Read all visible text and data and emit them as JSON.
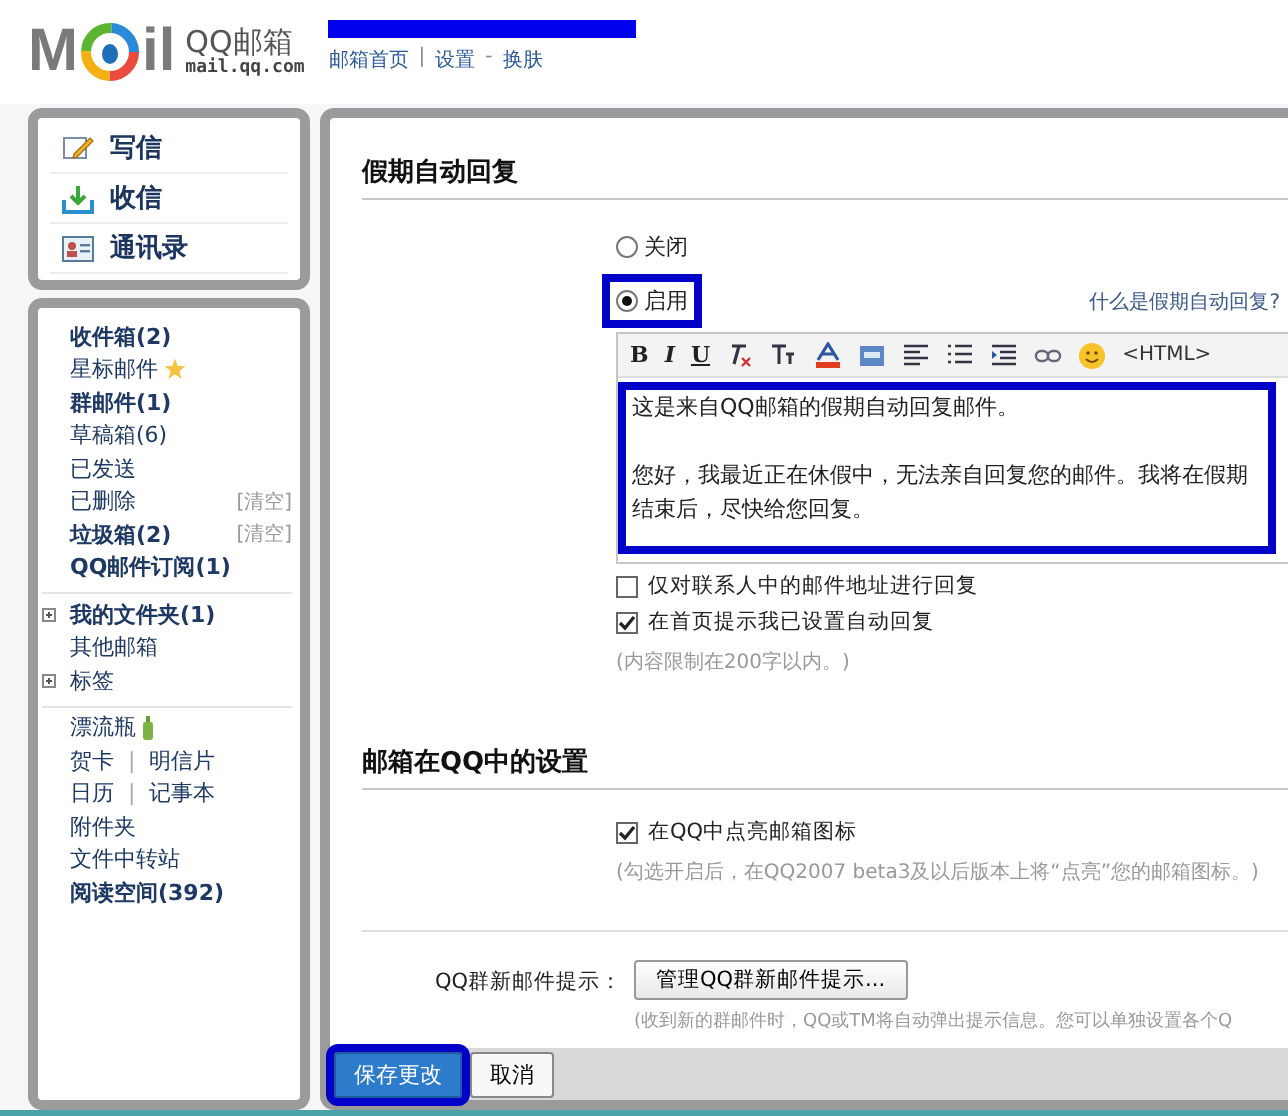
{
  "header": {
    "logo": {
      "left": "M",
      "right": "il",
      "name": "QQ邮箱",
      "domain": "mail.qq.com"
    },
    "account_redacted": true,
    "nav": [
      {
        "label": "邮箱首页"
      },
      {
        "separator": "|",
        "label": "设置"
      },
      {
        "separator": "-",
        "label": "换肤"
      }
    ]
  },
  "sidebar": {
    "actions": [
      {
        "kind": "compose",
        "label": "写信"
      },
      {
        "kind": "receive",
        "label": "收信"
      },
      {
        "kind": "contacts",
        "label": "通讯录"
      }
    ],
    "groups": [
      [
        {
          "label": "收件箱(2)",
          "bold": true
        },
        {
          "label": "星标邮件",
          "kind": "starred"
        },
        {
          "label": "群邮件(1)",
          "bold": true
        },
        {
          "label": "草稿箱(6)"
        },
        {
          "label": "已发送"
        },
        {
          "label": "已删除",
          "action": "[清空]"
        },
        {
          "label": "垃圾箱(2)",
          "bold": true,
          "action": "[清空]"
        },
        {
          "label": "QQ邮件订阅(1)",
          "bold": true
        }
      ],
      [
        {
          "label": "我的文件夹(1)",
          "bold": true,
          "expanded": false
        },
        {
          "label": "其他邮箱"
        },
        {
          "label": "标签",
          "expanded": false
        }
      ],
      [
        {
          "label": "漂流瓶",
          "kind": "bottle"
        },
        {
          "label": "贺卡",
          "separator": "|",
          "label2": "明信片"
        },
        {
          "label": "日历",
          "separator": "|",
          "label2": "记事本"
        },
        {
          "label": "附件夹"
        },
        {
          "label": "文件中转站"
        },
        {
          "label": "阅读空间(392)",
          "bold": true
        }
      ]
    ]
  },
  "vacation_reply": {
    "title": "假期自动回复",
    "options": [
      {
        "label": "关闭",
        "selected": false,
        "highlighted": false
      },
      {
        "label": "启用",
        "selected": true,
        "highlighted": true
      }
    ],
    "help_link": "什么是假期自动回复?",
    "toolbar_text": [
      {
        "kind": "bold",
        "label": "B"
      },
      {
        "kind": "italic",
        "label": "I"
      },
      {
        "kind": "underline",
        "label": "U"
      }
    ],
    "html_label": "<HTML>",
    "editor": {
      "highlighted": true,
      "paragraphs": [
        "这是来自QQ邮箱的假期自动回复邮件。",
        "您好，我最近正在休假中，无法亲自回复您的邮件。我将在假期结束后，尽快给您回复。"
      ]
    },
    "checkboxes": [
      {
        "label": "仅对联系人中的邮件地址进行回复",
        "checked": false
      },
      {
        "label": "在首页提示我已设置自动回复",
        "checked": true
      }
    ],
    "note": "(内容限制在200字以内。)"
  },
  "qq_settings": {
    "title": "邮箱在QQ中的设置",
    "checkbox": {
      "label": "在QQ中点亮邮箱图标",
      "checked": true
    },
    "note": "(勾选开启后，在QQ2007 beta3及以后版本上将“点亮”您的邮箱图标。)",
    "group_label": "QQ群新邮件提示：",
    "group_button": "管理QQ群新邮件提示...",
    "group_note": "(收到新的群邮件时，QQ或TM将自动弹出提示信息。您可以单独设置各个Q"
  },
  "footer": {
    "buttons": [
      {
        "label": "保存更改",
        "primary": true,
        "highlighted": true
      },
      {
        "label": "取消",
        "primary": false,
        "highlighted": false
      }
    ]
  }
}
